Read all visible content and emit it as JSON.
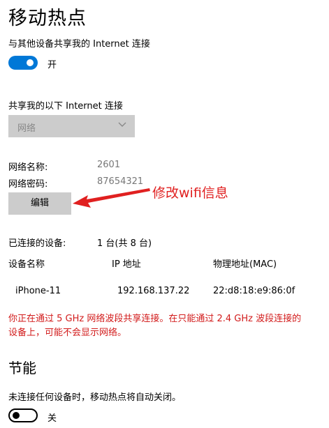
{
  "title": "移动热点",
  "share_label": "与其他设备共享我的 Internet 连接",
  "share_toggle_state": "开",
  "share_from_label": "共享我的以下 Internet 连接",
  "share_from_select": {
    "value": "网络"
  },
  "network_name_label": "网络名称:",
  "network_name_value": "2601",
  "network_password_label": "网络密码:",
  "network_password_value": "87654321",
  "edit_button": "编辑",
  "annotation": "修改wifi信息",
  "connected_label": "已连接的设备:",
  "connected_value": "1 台(共 8 台)",
  "table": {
    "headers": [
      "设备名称",
      "IP 地址",
      "物理地址(MAC)"
    ],
    "rows": [
      [
        "iPhone-11",
        "192.168.137.22",
        "22:d8:18:e9:86:0f"
      ]
    ]
  },
  "warning_line1": "你正在通过 5 GHz 网络波段共享连接。在只能通过 2.4 GHz 波段连接的",
  "warning_line2": "设备上，可能不会显示网络。",
  "power_title": "节能",
  "power_desc": "未连接任何设备时，移动热点将自动关闭。",
  "power_toggle_state": "关",
  "colors": {
    "accent": "#0078d7",
    "warning": "#d21b1b",
    "annotation": "#e02020",
    "control_bg": "#cccccc"
  }
}
